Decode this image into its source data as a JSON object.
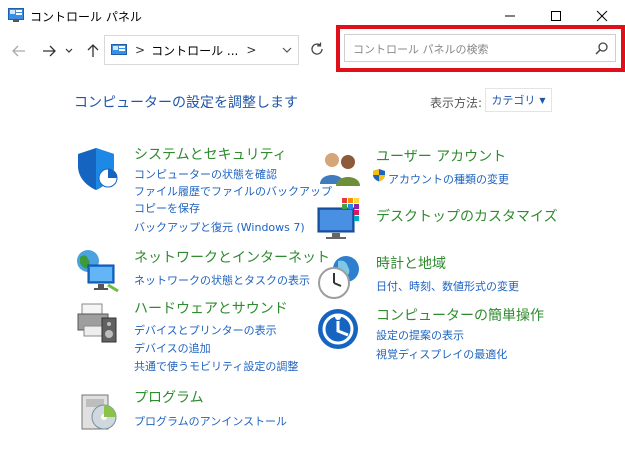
{
  "window": {
    "title": "コントロール パネル"
  },
  "nav": {
    "address_crumb": "コントロール ..."
  },
  "search": {
    "placeholder": "コントロール パネルの検索"
  },
  "header": {
    "heading": "コンピューターの設定を調整します",
    "view_by_label": "表示方法:",
    "view_by_value": "カテゴリ"
  },
  "left_categories": [
    {
      "title": "システムとセキュリティ",
      "links": [
        "コンピューターの状態を確認",
        "ファイル履歴でファイルのバックアップ",
        "コピーを保存",
        "バックアップと復元 (Windows 7)"
      ]
    },
    {
      "title": "ネットワークとインターネット",
      "links": [
        "ネットワークの状態とタスクの表示"
      ]
    },
    {
      "title": "ハードウェアとサウンド",
      "links": [
        "デバイスとプリンターの表示",
        "デバイスの追加",
        "共通で使うモビリティ設定の調整"
      ]
    },
    {
      "title": "プログラム",
      "links": [
        "プログラムのアンインストール"
      ]
    }
  ],
  "right_categories": [
    {
      "title": "ユーザー アカウント",
      "links": [
        "アカウントの種類の変更"
      ]
    },
    {
      "title": "デスクトップのカスタマイズ",
      "links": []
    },
    {
      "title": "時計と地域",
      "links": [
        "日付、時刻、数値形式の変更"
      ]
    },
    {
      "title": "コンピューターの簡単操作",
      "links": [
        "設定の提案の表示",
        "視覚ディスプレイの最適化"
      ]
    }
  ],
  "colors": {
    "link_blue": "#1e63c0",
    "category_green": "#2e8b2e",
    "heading_blue": "#1e56a8",
    "highlight_red": "#e0101a"
  }
}
